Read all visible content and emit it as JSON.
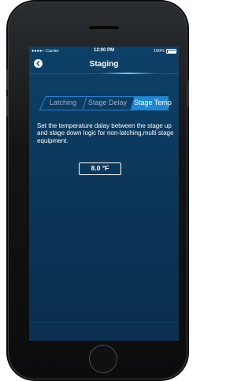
{
  "status_bar": {
    "carrier": "●●●●○ Carrier",
    "time": "12:00 PM",
    "battery": "100%"
  },
  "nav": {
    "title": "Staging",
    "back_icon": "back-arrow-icon"
  },
  "tabs": [
    {
      "label": "Latching",
      "selected": false
    },
    {
      "label": "Stage Delay",
      "selected": false
    },
    {
      "label": "Stage Temp",
      "selected": true
    }
  ],
  "content": {
    "description": "Set the temperature dalay between the stage up and stage down logic for non-latching,multi stage equipment.",
    "value": "8.0 °F"
  },
  "colors": {
    "background": "#0b3558",
    "accent": "#1e88d4",
    "text": "#ffffff"
  }
}
